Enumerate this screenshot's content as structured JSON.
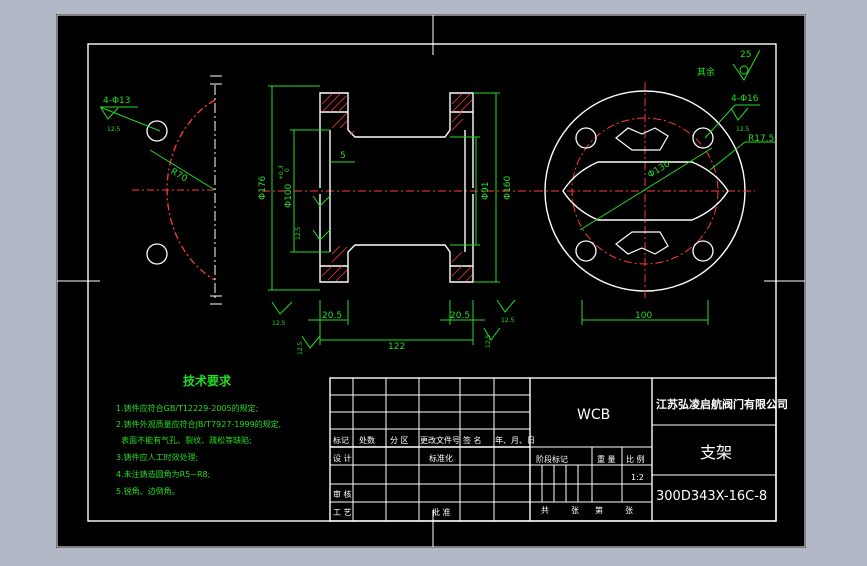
{
  "colors": {
    "background": "#b2b8c6",
    "sheet": "#000000",
    "outline": "#ffffff",
    "centerline": "#ff2a2a",
    "dimension": "#22dd22",
    "hatch": "#ff3333",
    "text_white": "#ffffff",
    "text_green": "#22dd22",
    "text_yellow": "#ffff00"
  },
  "left_view": {
    "holes_label": "4-Φ13",
    "roughness": "12.5",
    "radius_label": "R70"
  },
  "section_view": {
    "dim_outer_dia": "Φ176",
    "dim_bore": "Φ100",
    "dim_bore_tol_upper": "+0.3",
    "dim_bore_tol_lower": "0",
    "dim_gap": "5",
    "dim_inner": "Φ91",
    "dim_flange_dia": "Φ160",
    "dim_left_flange": "20.5",
    "dim_right_flange": "20.5",
    "dim_length": "122",
    "roughness_a": "12.5",
    "roughness_b": "12.5",
    "roughness_c": "12.5",
    "roughness_d": "12.5",
    "roughness_e": "12.5"
  },
  "right_view": {
    "holes_label": "4-Φ16",
    "roughness": "12.5",
    "radius_label": "R17.5",
    "pcd_label": "Φ130",
    "width_label": "100",
    "rest_label": "其余",
    "rest_value": "25"
  },
  "tech_requirements": {
    "title": "技术要求",
    "items": [
      "1.铸件应符合GB/T12229-2005的规定;",
      "2.铸件外观质量应符合JB/T7927-1999的规定,",
      "  表面不能有气孔、裂纹、疏松等缺陷;",
      "3.铸件应人工时效处理;",
      "4.未注铸造圆角为R5~R8;",
      "5.锐角、边倒角。"
    ]
  },
  "title_block": {
    "material": "WCB",
    "company": "江苏弘凌启航阀门有限公司",
    "part_name": "支架",
    "drawing_number": "300D343X-16C-8",
    "scale": "1:2",
    "col_headers": [
      "标记",
      "处数",
      "分 区",
      "更改文件号",
      "签 名",
      "年、月、日"
    ],
    "row_design": "设 计",
    "row_standard": "标准化",
    "row_review": "审 核",
    "row_process": "工 艺",
    "row_approve": "批 准",
    "stage_mark": "阶段标记",
    "weight": "重 量",
    "ratio": "比 例",
    "total": "共",
    "sheets": "张",
    "sheet_no": "第",
    "sheet_unit": "张"
  }
}
